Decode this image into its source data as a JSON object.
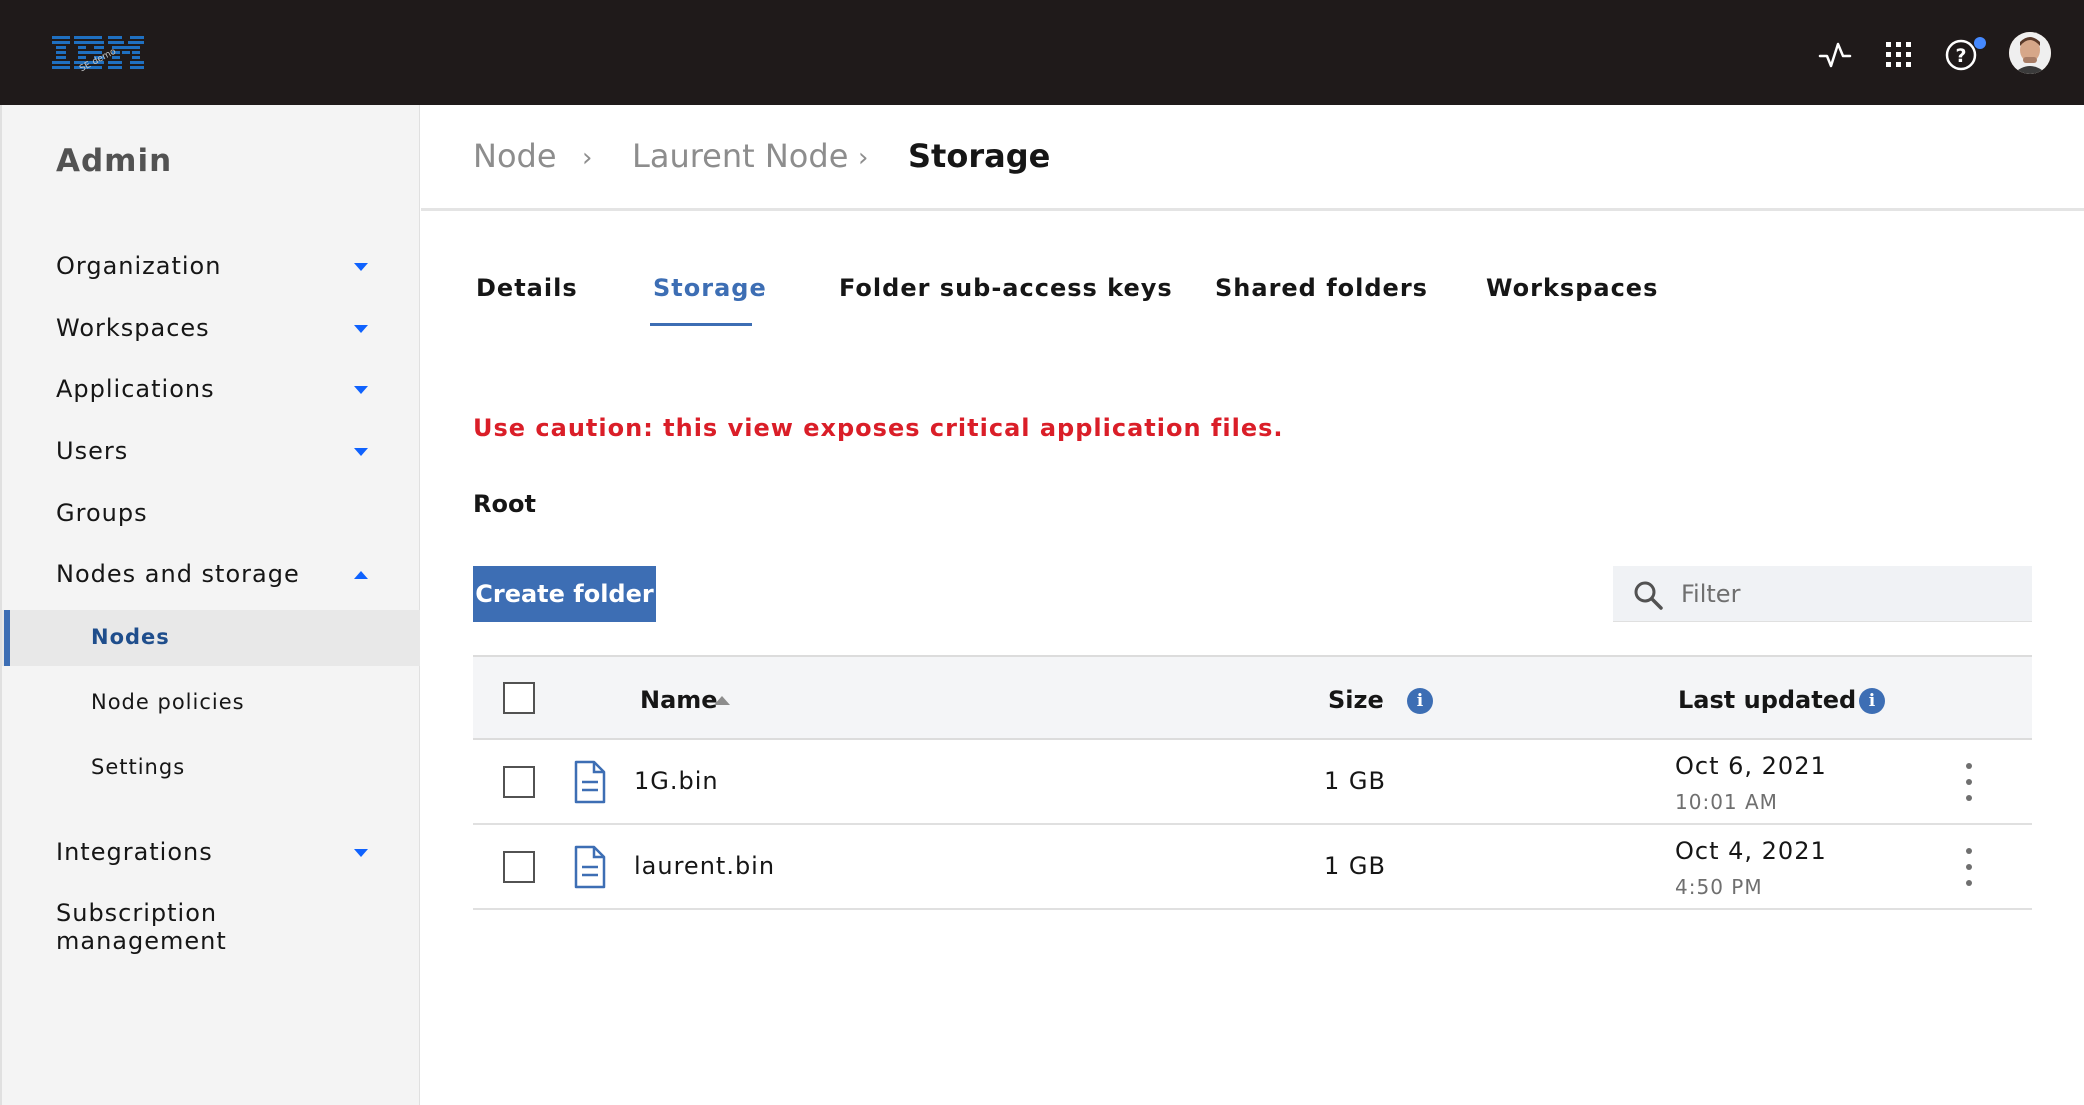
{
  "header": {
    "logo_text": "IBM",
    "logo_stamp": "SE demo",
    "icons": [
      "activity-icon",
      "app-switcher-icon",
      "help-icon",
      "avatar"
    ]
  },
  "sidebar": {
    "title": "Admin",
    "items": [
      {
        "label": "Organization",
        "expandable": true,
        "expanded": false
      },
      {
        "label": "Workspaces",
        "expandable": true,
        "expanded": false
      },
      {
        "label": "Applications",
        "expandable": true,
        "expanded": false
      },
      {
        "label": "Users",
        "expandable": true,
        "expanded": false
      },
      {
        "label": "Groups",
        "expandable": false
      },
      {
        "label": "Nodes and storage",
        "expandable": true,
        "expanded": true
      },
      {
        "label": "Integrations",
        "expandable": true,
        "expanded": false
      },
      {
        "label": "Subscription management",
        "line1": "Subscription",
        "line2": "management",
        "expandable": false
      }
    ],
    "subitems": [
      {
        "label": "Nodes",
        "active": true
      },
      {
        "label": "Node policies",
        "active": false
      },
      {
        "label": "Settings",
        "active": false
      }
    ]
  },
  "breadcrumb": [
    "Node",
    "Laurent Node",
    "Storage"
  ],
  "tabs": [
    {
      "label": "Details",
      "active": false
    },
    {
      "label": "Storage",
      "active": true
    },
    {
      "label": "Folder sub-access keys",
      "active": false
    },
    {
      "label": "Shared folders",
      "active": false
    },
    {
      "label": "Workspaces",
      "active": false
    }
  ],
  "caution": "Use caution: this view exposes critical application files.",
  "path_label": "Root",
  "create_button": "Create folder",
  "filter_placeholder": "Filter",
  "table": {
    "columns": {
      "name": "Name",
      "size": "Size",
      "updated": "Last updated"
    },
    "sort": {
      "column": "Name",
      "direction": "ascending"
    },
    "rows": [
      {
        "name": "1G.bin",
        "size": "1 GB",
        "date": "Oct 6, 2021",
        "time": "10:01 AM"
      },
      {
        "name": "laurent.bin",
        "size": "1 GB",
        "date": "Oct 4, 2021",
        "time": "4:50 PM"
      }
    ]
  },
  "colors": {
    "topbar": "#1f1a1a",
    "accent": "#3d6eb4",
    "caution": "#da1e28",
    "notification_dot": "#4589ff"
  }
}
